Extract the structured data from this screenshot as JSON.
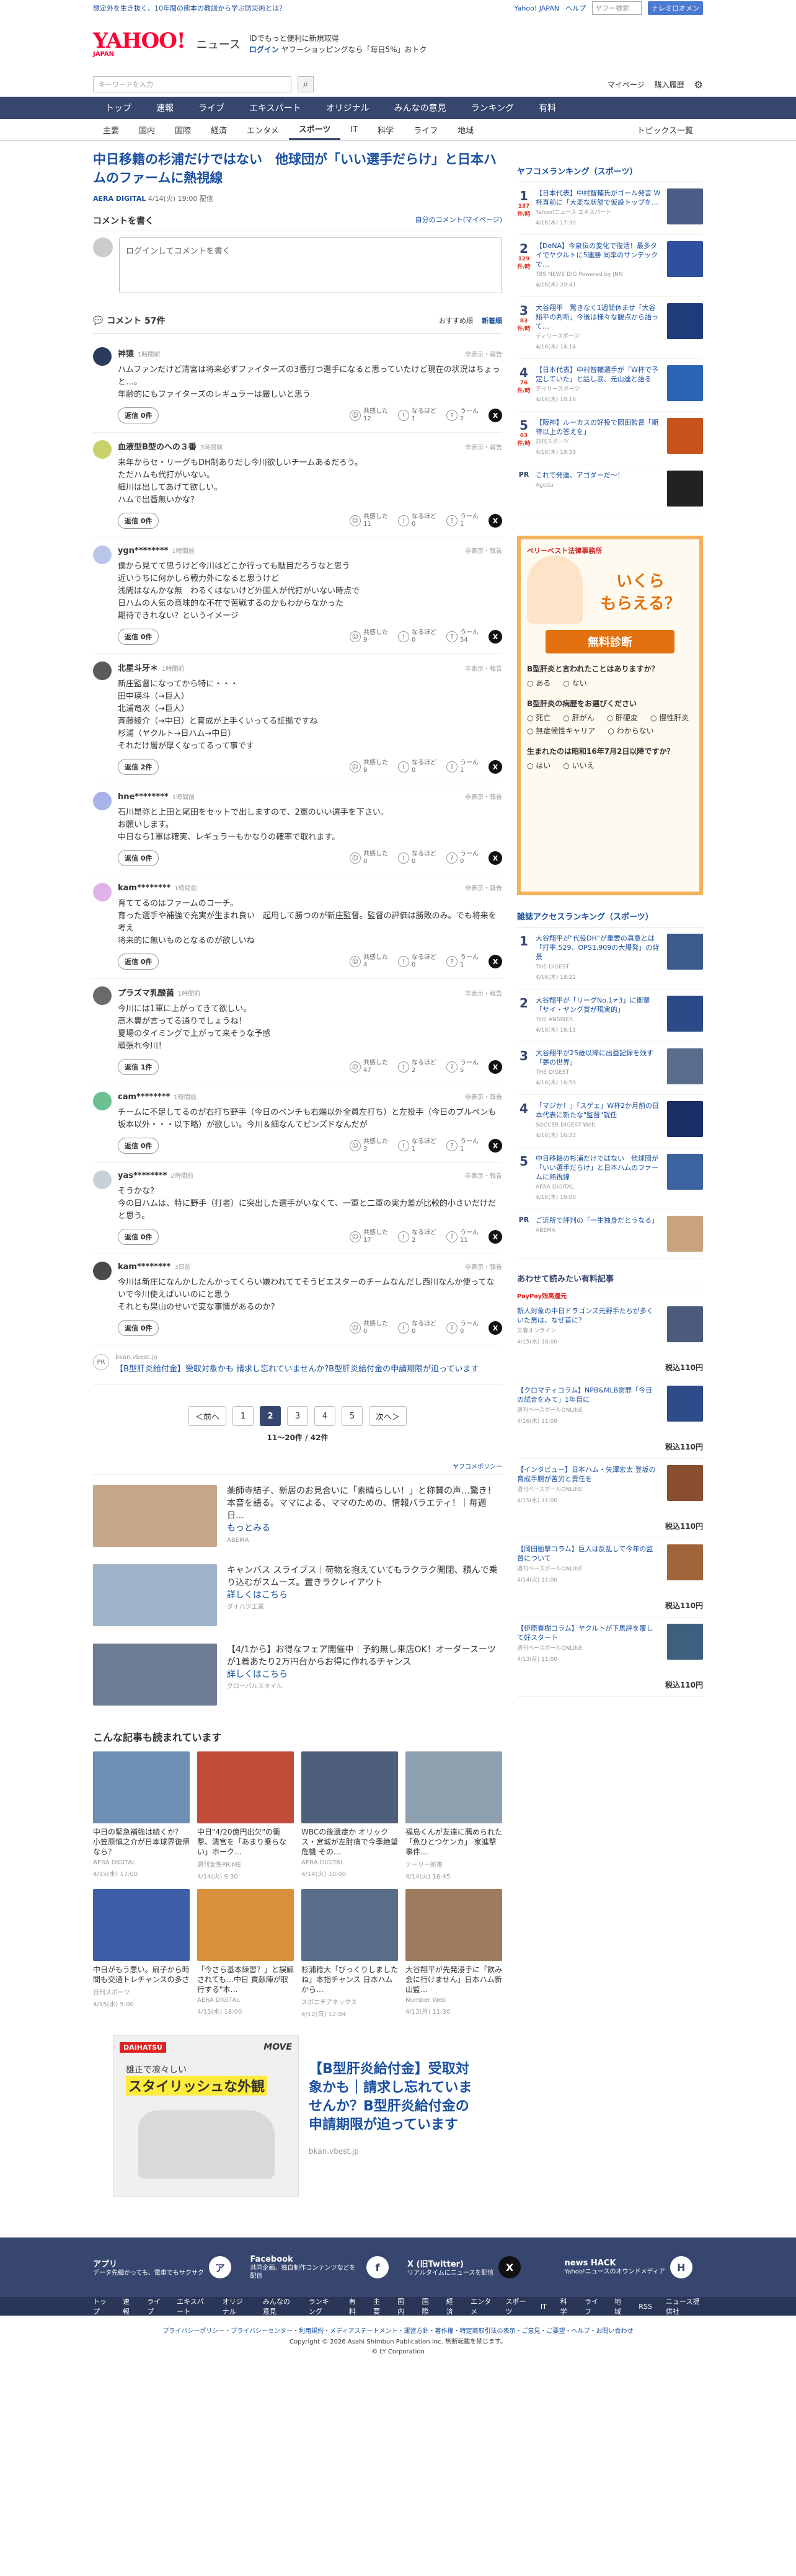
{
  "topbar": {
    "promo": "想定外を生き抜く、10年間の熊本の教訓から学ぶ防災術とは？",
    "links": [
      "Yahoo! JAPAN",
      "ヘルプ"
    ],
    "search_placeholder": "ヤフー検索",
    "search_btn": "ナレミロオメン"
  },
  "header": {
    "logo": "YAHOO!",
    "logo_sub": "JAPAN",
    "service": "ニュース",
    "promo1": "IDでもっと便利に新規取得",
    "promo2": "ログイン",
    "promo3": "ヤフーショッピングなら「毎日5%」おトク"
  },
  "searchbar": {
    "placeholder": "キーワードを入力",
    "mypage": "マイページ",
    "purchase": "購入履歴"
  },
  "gnav": [
    "トップ",
    "速報",
    "ライブ",
    "エキスパート",
    "オリジナル",
    "みんなの意見",
    "ランキング",
    "有料"
  ],
  "cnav": [
    "主要",
    "国内",
    "国際",
    "経済",
    "エンタメ",
    "スポーツ",
    "IT",
    "科学",
    "ライフ",
    "地域"
  ],
  "cnav_right": "トピックス一覧",
  "article": {
    "title": "中日移籍の杉浦だけではない　他球団が「いい選手だらけ」と日本ハムのファームに熱視線",
    "source": "AERA DIGITAL",
    "date": "4/14(火) 19:00 配信"
  },
  "comment_box": {
    "title": "コメントを書く",
    "link": "自分のコメント(マイページ)",
    "placeholder": "ログインしてコメントを書く"
  },
  "comments_head": {
    "title": "コメント 57件",
    "sort1": "おすすめ順",
    "sort2": "新着順"
  },
  "labels": {
    "report": "非表示・報告",
    "helpful": "共感した",
    "learned": "なるほど",
    "hmm": "うーん"
  },
  "comments": [
    {
      "user": "神猿",
      "time": "1時間前",
      "text": "ハムファンだけど清宮は将来必ずファイターズの3番打つ選手になると思っていたけど現在の状況はちょっと…。\n年齢的にもファイターズのレギュラーは厳しいと思う",
      "reply": "返信 0件",
      "a": "12",
      "b": "1",
      "c": "2"
    },
    {
      "user": "血液型B型のへの３番",
      "time": "3時間前",
      "text": "来年からセ・リーグもDH制ありだし今川欲しいチームあるだろう。\nただハムも代打がいない。\n細川は出してあげて欲しい。\nハムで出番無いかな？",
      "reply": "返信 0件",
      "a": "11",
      "b": "0",
      "c": "1"
    },
    {
      "user": "ygn********",
      "time": "1時間前",
      "text": "僕から見てて思うけど今川はどこか行っても駄目だろうなと思う\n近いうちに何かしら戦力外になると思うけど\n浅間はなんかな無　わるくはないけど外国人が代打がいない時点で\n日ハムの人気の意味的な不在で苦戦するのかもわからなかった\n期待できれない？というイメージ",
      "reply": "返信 0件",
      "a": "9",
      "b": "0",
      "c": "54"
    },
    {
      "user": "北星斗牙＊",
      "time": "1時間前",
      "text": "新庄監督になってから特に・・・\n田中瑛斗（→巨人）\n北浦竜次（→巨人）\n斉藤綾介（→中日）と育成が上手くいってる証拠ですね\n杉浦（ヤクルト→日ハム→中日）\nそれだけ層が厚くなってるって事です",
      "reply": "返信 2件",
      "a": "9",
      "b": "0",
      "c": "1"
    },
    {
      "user": "hne********",
      "time": "1時間前",
      "text": "石川昂弥と上田と尾田をセットで出しますので、2軍のいい選手を下さい。\nお願いします。\n中日なら1軍は確実、レギュラーもかなりの確率で取れます。",
      "reply": "返信 0件",
      "a": "0",
      "b": "0",
      "c": "0"
    },
    {
      "user": "kam********",
      "time": "1時間前",
      "text": "育ててるのはファームのコーチ。\n育った選手や補強で充実が生まれ良い　起用して勝つのが新庄監督。監督の評価は勝敗のみ。でも将来を考え\n将来的に無いものとなるのが欲しいね",
      "reply": "返信 0件",
      "a": "4",
      "b": "0",
      "c": "1"
    },
    {
      "user": "プラズマ乳酸菌",
      "time": "1時間前",
      "text": "今川には1軍に上がってきて欲しい。\n高木豊が言ってる通りでしょうね！\n夏場のタイミングで上がって来そうな予感\n頑張れ今川！",
      "reply": "返信 1件",
      "a": "47",
      "b": "2",
      "c": "5"
    },
    {
      "user": "cam********",
      "time": "1時間前",
      "text": "チームに不足してるのが右打ち野手（今日のベンチも右端以外全員左打ち）と左投手（今日のブルペンも坂本以外・・・以下略）が欲しい。今川＆細なんてピンズドなんだが",
      "reply": "返信 0件",
      "a": "3",
      "b": "1",
      "c": "1"
    },
    {
      "user": "yas********",
      "time": "2時間前",
      "text": "そうかな？\n今の日ハムは、特に野手（打者）に突出した選手がいなくて、一軍と二軍の実力差が比較的小さいだけだと思う。",
      "reply": "返信 0件",
      "a": "17",
      "b": "2",
      "c": "11"
    },
    {
      "user": "kam********",
      "time": "3日前",
      "text": "今川は新庄になんかしたんかってくらい嫌われててそうビエスターのチームなんだし西川なんか使ってないで今川使えばいいのにと思う\nそれとも果山のせいで変な事情があるのか？",
      "reply": "返信 0件",
      "a": "0",
      "b": "0",
      "c": "0"
    }
  ],
  "pr_comment": {
    "tag": "PR",
    "src": "bkan.vbest.jp",
    "text": "【B型肝炎給付金】受取対象かも 請求し忘れていませんか?B型肝炎給付金の申請期限が迫っています"
  },
  "pager": {
    "prev": "＜前へ",
    "pages": [
      "1",
      "2",
      "3",
      "4",
      "5"
    ],
    "current": "2",
    "next": "次へ＞",
    "info": "11〜20件 / 42件"
  },
  "ad_policy": "ヤフコメポリシー",
  "ads": [
    {
      "text": "薬師寺結子、新居のお見合いに「素晴らしい！」と称賛の声…驚き！本音を語る。ママによる、ママのための、情報バラエティ！｜毎週日…",
      "link": "もっとみる",
      "adv": "ABEMA",
      "color": "#c4a888"
    },
    {
      "text": "キャンバス スライブス｜荷物を抱えていてもラクラク開閉、積んで乗り込むがスムーズ。置きラクレイアウト",
      "link": "詳しくはこちら",
      "adv": "ダイハツ工業",
      "color": "#9fb3c8"
    },
    {
      "text": "【4/1から】お得なフェア開催中｜予約無し来店OK！オーダースーツが1着あたり2万円台からお得に作れるチャンス",
      "link": "詳しくはこちら",
      "adv": "グローバルスタイル",
      "color": "#6f7d94"
    }
  ],
  "related": {
    "title": "こんな記事も読まれています",
    "items": [
      {
        "title": "中日の緊急補強は続くか？ 小笠原慎之介が日本球界復帰なら？",
        "src": "AERA DIGITAL",
        "date": "4/15(水) 17:00",
        "color": "#6c8fb3"
      },
      {
        "title": "中日\"4/20億円出欠\"の衝撃、清宮を「あまり乗らない」ホーク…",
        "src": "週刊女性PRIME",
        "date": "4/14(火) 9:30",
        "color": "#c24c3a"
      },
      {
        "title": "WBCの後遺症か オリックス・宮城が左肘痛で今季絶望危機 その…",
        "src": "AERA DIGITAL",
        "date": "4/14(火) 10:00",
        "color": "#4d5f7a"
      },
      {
        "title": "福島くんが友達に薦められた「魚ひとつケンカ」 家進撃事件…",
        "src": "テーリー新書",
        "date": "4/14(火) 16:45",
        "color": "#8ea0b0"
      },
      {
        "title": "中日がもう悪い。扇子から時間も交通トレチャンスの多さ",
        "src": "日刊スポーツ",
        "date": "4/15(水) 5:00",
        "color": "#3f5ea8"
      },
      {
        "title": "「今さら基本練習？」と誤解されても…中日 貢献陣が取行する\"本…",
        "src": "AERA DIGITAL",
        "date": "4/15(水) 18:00",
        "color": "#d9903c"
      },
      {
        "title": "杉浦稔大「びっくりしましたね」本指チャンス 日本ハムから…",
        "src": "スポニチアネックス",
        "date": "4/12(日) 12:04",
        "color": "#5a6e8a"
      },
      {
        "title": "大谷翔平が先発浸手に「飲み会に行けません」日本ハム新山監…",
        "src": "Number Web",
        "date": "4/13(月) 11:30",
        "color": "#9c7c5c"
      }
    ]
  },
  "big_ad": {
    "badge": "DAIHATSU",
    "brand": "MOVE",
    "catch1": "雄正で凛々しい",
    "catch2": "スタイリッシュな外観",
    "text": "【B型肝炎給付金】受取対象かも｜請求し忘れていませんか？B型肝炎給付金の申請期限が迫っています",
    "src": "bkan.vbest.jp"
  },
  "sports_rank": {
    "title": "ヤフコメランキング（スポーツ）",
    "items": [
      {
        "rank": "1",
        "count": "137",
        "unit": "件/時",
        "title": "【日本代表】中村智輔氏がゴール発言 W杯直前に「大変な状態で仮設トップを…",
        "src": "Yahoo!ニュース エキスパート",
        "date": "4/16(木) 17:30",
        "color": "#4a5d88"
      },
      {
        "rank": "2",
        "count": "129",
        "unit": "件/時",
        "title": "【DeNA】今泉伝の変化で復活！最多タイでヤクルトに5連勝 同率のサンテックで…",
        "src": "TBS NEWS DIG Powered by JNN",
        "date": "4/16(木) 20:41",
        "color": "#2f4f9f"
      },
      {
        "rank": "3",
        "count": "83",
        "unit": "件/時",
        "title": "大谷翔平　驚きなく1週間休ませ「大谷翔平の判断」今後は様々な観点から語って…",
        "src": "ディリースポーツ",
        "date": "4/16(木) 14:14",
        "color": "#1f3d7a"
      },
      {
        "rank": "4",
        "count": "76",
        "unit": "件/時",
        "title": "【日本代表】中村智輔選手が「W杯で予定していた」と話し涙、元山達と語る",
        "src": "デイリースポーツ",
        "date": "4/16(木) 18:16",
        "color": "#2b64b5"
      },
      {
        "rank": "5",
        "count": "63",
        "unit": "件/時",
        "title": "【阪神】ルーカスの好投で岡田監督「期待以上の答えを」",
        "src": "日刊スポーツ",
        "date": "4/16(木) 19:39",
        "color": "#c8531c"
      }
    ],
    "pr": {
      "tag": "PR",
      "title": "これで発達、アゴダーだ〜！",
      "src": "Agoda"
    }
  },
  "quiz": {
    "brand": "ベリーベスト法律事務所",
    "big1": "いくら",
    "big2": "もらえる？",
    "btn": "無料診断",
    "q1": "B型肝炎と言われたことはありますか？",
    "o1": [
      "ある",
      "ない"
    ],
    "q2": "B型肝炎の病歴をお選びください",
    "o2": [
      "死亡",
      "肝がん",
      "肝硬変",
      "慢性肝炎",
      "無症候性キャリア",
      "わからない"
    ],
    "q3": "生まれたのは昭和16年7月2日以降ですか？",
    "o3": [
      "はい",
      "いいえ"
    ]
  },
  "access_rank": {
    "title": "雑誌アクセスランキング（スポーツ）",
    "items": [
      {
        "rank": "1",
        "title": "大谷翔平が\"代役DH\"が重要の真意とは「打率.529、OPS1.909の大爆発」の背景",
        "src": "THE DIGEST",
        "date": "4/16(木) 18:22",
        "color": "#3a5b8c"
      },
      {
        "rank": "2",
        "title": "大谷翔平が「リーグNo.1≠3」に衝撃「サイ・ヤング賞が現実的」",
        "src": "THE ANSWER",
        "date": "4/16(木) 16:13",
        "color": "#2b4a88"
      },
      {
        "rank": "3",
        "title": "大谷翔平が25歳以降に出塁記録を残す「夢の世界」",
        "src": "THE DIGEST",
        "date": "4/16(木) 16:59",
        "color": "#5a6c8c"
      },
      {
        "rank": "4",
        "title": "「マジか！」「スゲェ」W杯2か月前の日本代表に新たな\"監督\"就任",
        "src": "SOCCER DIGEST Web",
        "date": "4/16(木) 16:33",
        "color": "#1b2f66"
      },
      {
        "rank": "5",
        "title": "中日移籍の杉浦だけではない　他球団が「いい選手だらけ」と日本ハムのファームに熱視線",
        "src": "AERA DIGITAL",
        "date": "4/16(木) 19:00",
        "color": "#3d62a0"
      }
    ],
    "pr": {
      "tag": "PR",
      "title": "ご近所で評判の「一生独身だとうなる」",
      "src": "ABEMA"
    }
  },
  "shopping": {
    "title": "あわせて読みたい有料記事",
    "brand": "PayPay残高還元",
    "items": [
      {
        "title": "新人対象の中日ドラゴンズ元野手たちが多くいた男は、なぜ首に？",
        "src": "文春オンライン",
        "date": "4/15(水) 18:00",
        "price": "税込110円",
        "color": "#4b5b7b"
      },
      {
        "title": "【クロマティコラム】NPB&MLB謝罪「今日の試合をみて」1年目に",
        "src": "週刊ベースボールONLINE",
        "date": "4/16(木) 11:00",
        "price": "税込110円",
        "color": "#2e4b8a"
      },
      {
        "title": "【インタビュー】日本ハム・矢澤宏太 登坂の育成手腕が苦労と責任を",
        "src": "週刊ベースボールONLINE",
        "date": "4/15(水) 11:00",
        "price": "税込110円",
        "color": "#8a4f30"
      },
      {
        "title": "【岡田衝撃コラム】巨人は反乱して今年の監督について",
        "src": "週刊ベースボールONLINE",
        "date": "4/14(火) 11:00",
        "price": "税込110円",
        "color": "#a0643a"
      },
      {
        "title": "【伊原春樹コラム】ヤクルトが下馬評を覆して好スタート",
        "src": "週刊ベースボールONLINE",
        "date": "4/13(月) 11:00",
        "price": "税込110円",
        "color": "#3f5f7f"
      }
    ]
  },
  "footer": {
    "cols": [
      {
        "title": "アプリ",
        "desc": "データ先細かっても、電車でもサクサク",
        "icon": "ア"
      },
      {
        "title": "Facebook",
        "desc": "共同企画、独自制作コンテンツなどを配信",
        "icon": "f"
      },
      {
        "title": "X (旧Twitter)",
        "desc": "リアルタイムにニュースを配信",
        "icon": "X"
      },
      {
        "title": "news HACK",
        "desc": "Yahoo!ニュースのオウンドメディア",
        "icon": "H"
      }
    ],
    "nav": [
      "トップ",
      "速報",
      "ライブ",
      "エキスパート",
      "オリジナル",
      "みんなの意見",
      "ランキング",
      "有料",
      "主要",
      "国内",
      "国際",
      "経済",
      "エンタメ",
      "スポーツ",
      "IT",
      "科学",
      "ライフ",
      "地域",
      "RSS",
      "ニュース提供社"
    ],
    "links": "プライバシーポリシー・プライバシーセンター・利用規約・メディアステートメント・運営方針・著作権・特定商取引法の表示・ご意見・ご要望・ヘルプ・お問い合わせ",
    "copy1": "Copyright © 2026 Asahi Shimbun Publication Inc. 無断転載を禁じます。",
    "copy2": "© LY Corporation"
  }
}
